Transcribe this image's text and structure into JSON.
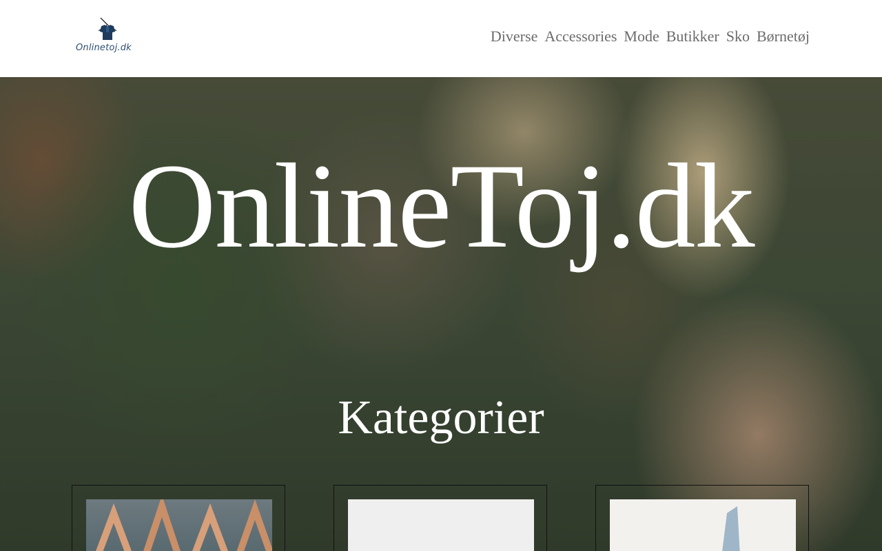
{
  "header": {
    "logo_text": "Onlinetoj.dk",
    "nav": [
      "Diverse",
      "Accessories",
      "Mode",
      "Butikker",
      "Sko",
      "Børnetøj"
    ]
  },
  "hero": {
    "title": "OnlineToj.dk",
    "section_title": "Kategorier"
  },
  "colors": {
    "nav_text": "#6b6b6b",
    "logo_blue": "#2f4f74",
    "hero_text": "#ffffff"
  },
  "icons": [
    "shirt-on-hanger-icon"
  ]
}
